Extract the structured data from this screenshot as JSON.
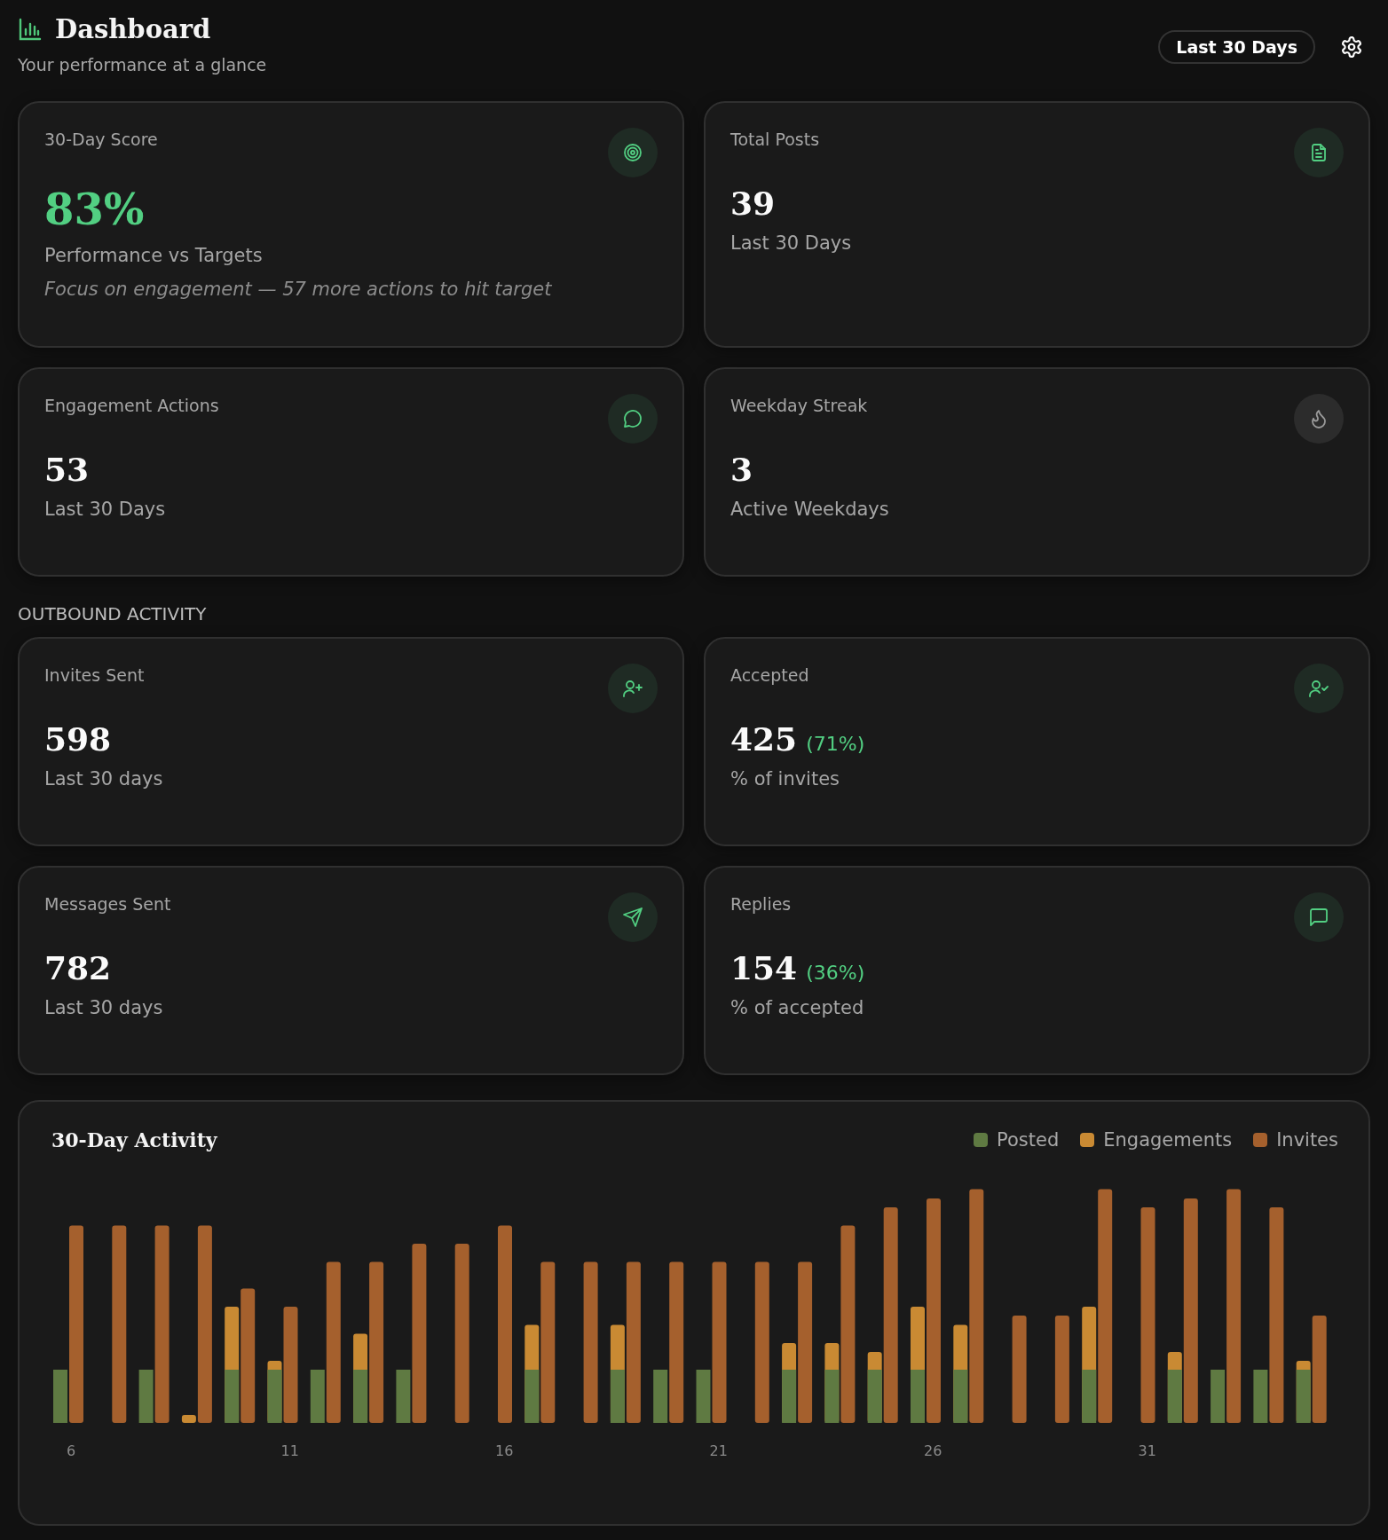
{
  "header": {
    "title": "Dashboard",
    "subtitle": "Your performance at a glance",
    "range_button": "Last 30 Days"
  },
  "summary_cards": [
    {
      "label": "30-Day Score",
      "value": "83%",
      "value_accent": true,
      "caption": "Performance vs Targets",
      "note": "Focus on engagement — 57 more actions to hit target",
      "kind": "target",
      "highlighted": true
    },
    {
      "label": "Total Posts",
      "value": "39",
      "value_accent": false,
      "caption": "Last 30 Days",
      "kind": "document",
      "highlighted": true
    },
    {
      "label": "Engagement Actions",
      "value": "53",
      "value_accent": false,
      "caption": "Last 30 Days",
      "kind": "chat-round",
      "highlighted": true
    },
    {
      "label": "Weekday Streak",
      "value": "3",
      "value_accent": false,
      "caption": "Active Weekdays",
      "kind": "flame",
      "highlighted": false
    }
  ],
  "section_title": "OUTBOUND ACTIVITY",
  "outbound_cards": [
    {
      "label": "Invites Sent",
      "value": "598",
      "value_accent": false,
      "caption": "Last 30 days",
      "kind": "user-plus",
      "highlighted": true
    },
    {
      "label": "Accepted",
      "value": "425",
      "value_accent": false,
      "rate": "(71%)",
      "caption": "% of invites",
      "kind": "user-check",
      "highlighted": true
    },
    {
      "label": "Messages Sent",
      "value": "782",
      "value_accent": false,
      "caption": "Last 30 days",
      "kind": "send",
      "highlighted": true
    },
    {
      "label": "Replies",
      "value": "154",
      "value_accent": false,
      "rate": "(36%)",
      "caption": "% of accepted",
      "kind": "chat-square",
      "highlighted": true
    }
  ],
  "activity": {
    "title": "30-Day Activity",
    "legend": [
      {
        "label": "Posted",
        "color": "#5f7a42"
      },
      {
        "label": "Engagements",
        "color": "#c98a33"
      },
      {
        "label": "Invites",
        "color": "#a5602d"
      }
    ],
    "x_labels": [
      "6",
      "11",
      "16",
      "21",
      "26",
      "31"
    ]
  }
}
